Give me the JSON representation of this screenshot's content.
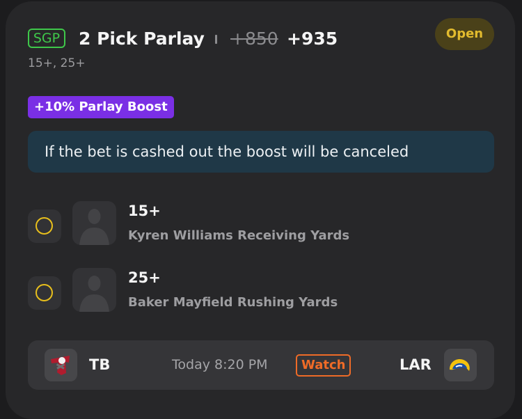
{
  "header": {
    "badge": "SGP",
    "title": "2 Pick Parlay",
    "odds_original": "+850",
    "odds_boosted": "+935",
    "subtitle": "15+, 25+",
    "status": "Open"
  },
  "boost": {
    "label": "+10% Parlay Boost",
    "notice": "If the bet is cashed out the boost will be canceled"
  },
  "legs": [
    {
      "line": "15+",
      "market": "Kyren Williams Receiving Yards"
    },
    {
      "line": "25+",
      "market": "Baker Mayfield Rushing Yards"
    }
  ],
  "game": {
    "away_team": "TB",
    "time": "Today 8:20 PM",
    "watch_label": "Watch",
    "home_team": "LAR"
  },
  "icons": {
    "leg_status": "empty-circle-icon",
    "player": "player-silhouette-icon",
    "away_logo": "buccaneers-logo",
    "home_logo": "rams-logo"
  },
  "colors": {
    "card_background": "#272729",
    "sgp_green": "#3fc84a",
    "status_yellow": "#e2bb2e",
    "boost_purple": "#7a2fe5",
    "notice_blue": "#1f3847",
    "watch_orange": "#ef6b27"
  }
}
